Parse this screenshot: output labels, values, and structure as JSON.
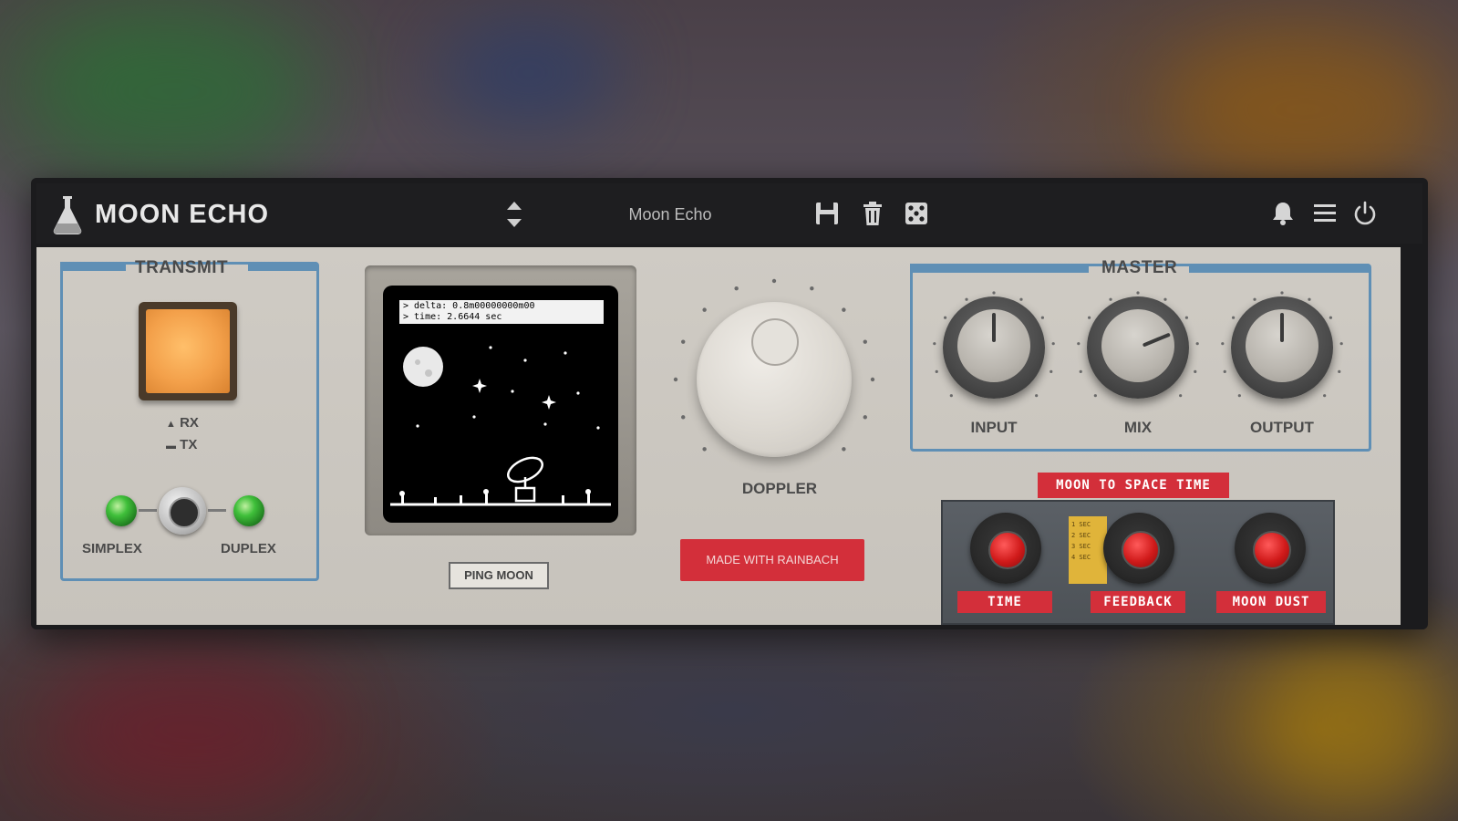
{
  "plugin": {
    "title": "MOON ECHO",
    "preset_name": "Moon Echo"
  },
  "toolbar": {
    "icons": [
      "preset-arrows-icon",
      "save-icon",
      "trash-icon",
      "dice-icon",
      "bell-icon",
      "menu-icon",
      "power-icon"
    ]
  },
  "transmit": {
    "title": "TRANSMIT",
    "rx_label": "RX",
    "tx_label": "TX",
    "simplex_label": "SIMPLEX",
    "duplex_label": "DUPLEX"
  },
  "screen": {
    "readout_line1": "> delta: 0.8m00000000m00",
    "readout_line2": "> time: 2.6644 sec"
  },
  "ping_button": {
    "label": "PING MOON"
  },
  "doppler": {
    "label": "DOPPLER"
  },
  "made_with": {
    "label": "MADE WITH RAINBACH"
  },
  "master": {
    "title": "MASTER",
    "knobs": [
      {
        "label": "INPUT",
        "value": 0.5
      },
      {
        "label": "MIX",
        "value": 0.75
      },
      {
        "label": "OUTPUT",
        "value": 0.5
      }
    ]
  },
  "space_time": {
    "title": "MOON TO SPACE TIME",
    "yellow_tag": "1 SEC\n2 SEC\n3 SEC\n4 SEC",
    "knobs": [
      {
        "label": "TIME"
      },
      {
        "label": "FEEDBACK"
      },
      {
        "label": "MOON DUST"
      }
    ]
  },
  "colors": {
    "accent_blue": "#5f8fb5",
    "accent_red": "#d32f3a",
    "transmit_orange": "#f3a04a",
    "led_green": "#3fbf3a"
  }
}
